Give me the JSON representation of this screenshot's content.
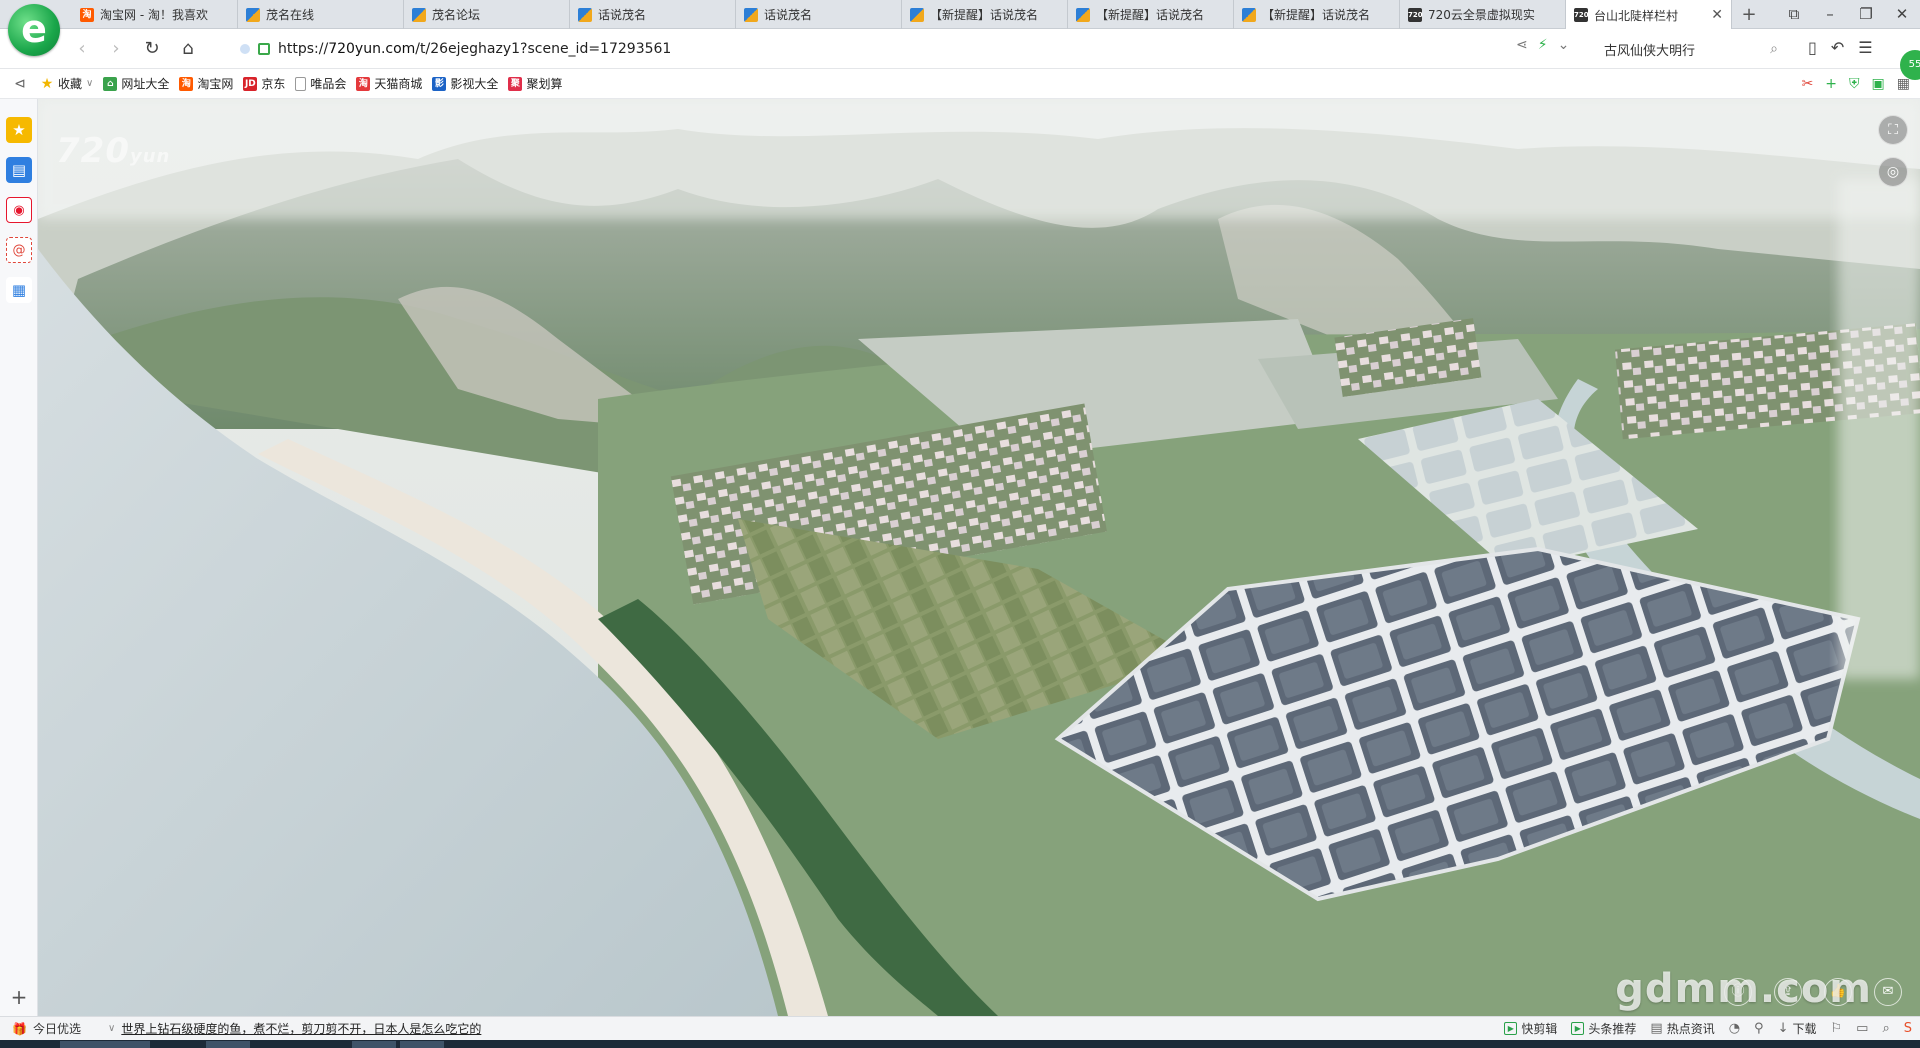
{
  "browser": {
    "logo_glyph": "e",
    "tabs": [
      {
        "icon": "taobao-favicon",
        "icon_text": "淘",
        "label": "淘宝网 - 淘！我喜欢",
        "active": false
      },
      {
        "icon": "maoming-favicon",
        "icon_text": "",
        "label": "茂名在线",
        "active": false
      },
      {
        "icon": "maoming-favicon",
        "icon_text": "",
        "label": "茂名论坛",
        "active": false
      },
      {
        "icon": "maoming-favicon",
        "icon_text": "",
        "label": "话说茂名",
        "active": false
      },
      {
        "icon": "maoming-favicon",
        "icon_text": "",
        "label": "话说茂名",
        "active": false
      },
      {
        "icon": "maoming-favicon",
        "icon_text": "",
        "label": "【新提醒】话说茂名",
        "active": false
      },
      {
        "icon": "maoming-favicon",
        "icon_text": "",
        "label": "【新提醒】话说茂名",
        "active": false
      },
      {
        "icon": "maoming-favicon",
        "icon_text": "",
        "label": "【新提醒】话说茂名",
        "active": false
      },
      {
        "icon": "yun720-favicon",
        "icon_text": "720",
        "label": "720云全景虚拟现实",
        "active": false
      },
      {
        "icon": "yun720-favicon",
        "icon_text": "720",
        "label": "台山北陡样栏村",
        "active": true
      }
    ],
    "tab_close_glyph": "✕",
    "new_tab_glyph": "+",
    "window_buttons": [
      "⧉",
      "–",
      "❐",
      "✕"
    ],
    "address": {
      "url_scheme": "https://",
      "url_host": "720yun.com",
      "url_path": "/t/26ejeghazy1?scene_id=17293561"
    },
    "search_box_text": "古风仙侠大明行",
    "profile_badge": "55"
  },
  "bookmarks": {
    "items": [
      {
        "icon": "star-icon",
        "icon_text": "★",
        "label": "收藏",
        "has_caret": true
      },
      {
        "icon": "home-icon",
        "icon_text": "⌂",
        "label": "网址大全"
      },
      {
        "icon": "taobao-icon",
        "icon_text": "淘",
        "label": "淘宝网"
      },
      {
        "icon": "jd-icon",
        "icon_text": "JD",
        "label": "京东"
      },
      {
        "icon": "document-icon",
        "icon_text": "",
        "label": "唯品会"
      },
      {
        "icon": "tmall-icon",
        "icon_text": "淘",
        "label": "天猫商城"
      },
      {
        "icon": "video-icon",
        "icon_text": "影",
        "label": "影视大全"
      },
      {
        "icon": "juhuasuan-icon",
        "icon_text": "聚",
        "label": "聚划算"
      }
    ]
  },
  "panorama": {
    "brand_text": "720",
    "brand_sub": "yun",
    "watermark": "gdmm.com"
  },
  "statusbar": {
    "left_label": "今日优选",
    "news_text": "世界上钻石级硬度的鱼，煮不烂，剪刀剪不开，日本人是怎么吃它的",
    "right_items": [
      "快剪辑",
      "头条推荐",
      "热点资讯",
      "下载"
    ]
  },
  "colors": {
    "accent_green": "#2fb24c",
    "tab_strip": "#dfe3e8",
    "taobao_orange": "#ff5a00"
  }
}
